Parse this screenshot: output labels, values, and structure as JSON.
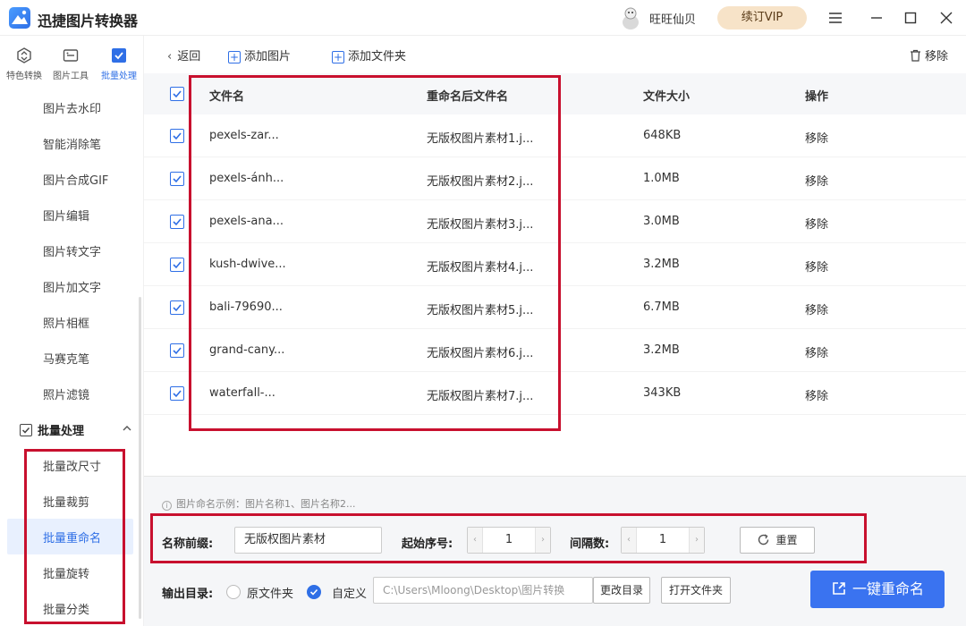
{
  "app": {
    "title": "迅捷图片转换器"
  },
  "user": {
    "name": "旺旺仙贝",
    "vip_label": "续订VIP"
  },
  "window_controls": [
    "menu-icon",
    "minimize-icon",
    "maximize-icon",
    "close-icon"
  ],
  "rail": {
    "tabs": [
      {
        "label": "特色转换",
        "icon": "special-convert-icon"
      },
      {
        "label": "图片工具",
        "icon": "image-tools-icon"
      },
      {
        "label": "批量处理",
        "icon": "batch-icon",
        "active": true
      }
    ]
  },
  "sidebar": {
    "items": [
      "图片去水印",
      "智能消除笔",
      "图片合成GIF",
      "图片编辑",
      "图片转文字",
      "图片加文字",
      "照片相框",
      "马赛克笔",
      "照片滤镜"
    ],
    "section": "批量处理",
    "section_items": [
      "批量改尺寸",
      "批量裁剪",
      "批量重命名",
      "批量旋转",
      "批量分类"
    ],
    "active": "批量重命名"
  },
  "toolbar": {
    "back": "返回",
    "add_image": "添加图片",
    "add_folder": "添加文件夹",
    "remove": "移除"
  },
  "table": {
    "headers": {
      "filename": "文件名",
      "renamed": "重命名后文件名",
      "size": "文件大小",
      "action": "操作"
    },
    "rows": [
      {
        "filename": "pexels-zar...",
        "renamed": "无版权图片素材1.j...",
        "size": "648KB",
        "action": "移除"
      },
      {
        "filename": "pexels-ánh...",
        "renamed": "无版权图片素材2.j...",
        "size": "1.0MB",
        "action": "移除"
      },
      {
        "filename": "pexels-ana...",
        "renamed": "无版权图片素材3.j...",
        "size": "3.0MB",
        "action": "移除"
      },
      {
        "filename": "kush-dwive...",
        "renamed": "无版权图片素材4.j...",
        "size": "3.2MB",
        "action": "移除"
      },
      {
        "filename": "bali-79690...",
        "renamed": "无版权图片素材5.j...",
        "size": "6.7MB",
        "action": "移除"
      },
      {
        "filename": "grand-cany...",
        "renamed": "无版权图片素材6.j...",
        "size": "3.2MB",
        "action": "移除"
      },
      {
        "filename": "waterfall-...",
        "renamed": "无版权图片素材7.j...",
        "size": "343KB",
        "action": "移除"
      }
    ]
  },
  "settings": {
    "hint": "图片命名示例：图片名称1、图片名称2...",
    "prefix_label": "名称前缀:",
    "prefix_value": "无版权图片素材",
    "start_label": "起始序号:",
    "start_value": "1",
    "interval_label": "间隔数:",
    "interval_value": "1",
    "reset_label": "重置",
    "output_label": "输出目录:",
    "option_original": "原文件夹",
    "option_custom": "自定义",
    "selected_option": "自定义",
    "output_path": "C:\\Users\\Mloong\\Desktop\\图片转换",
    "change_dir": "更改目录",
    "open_folder": "打开文件夹",
    "run_button": "一键重命名"
  },
  "colors": {
    "accent": "#2f6fe6",
    "highlight": "#c8102e",
    "vip": "#f7e3c8"
  }
}
